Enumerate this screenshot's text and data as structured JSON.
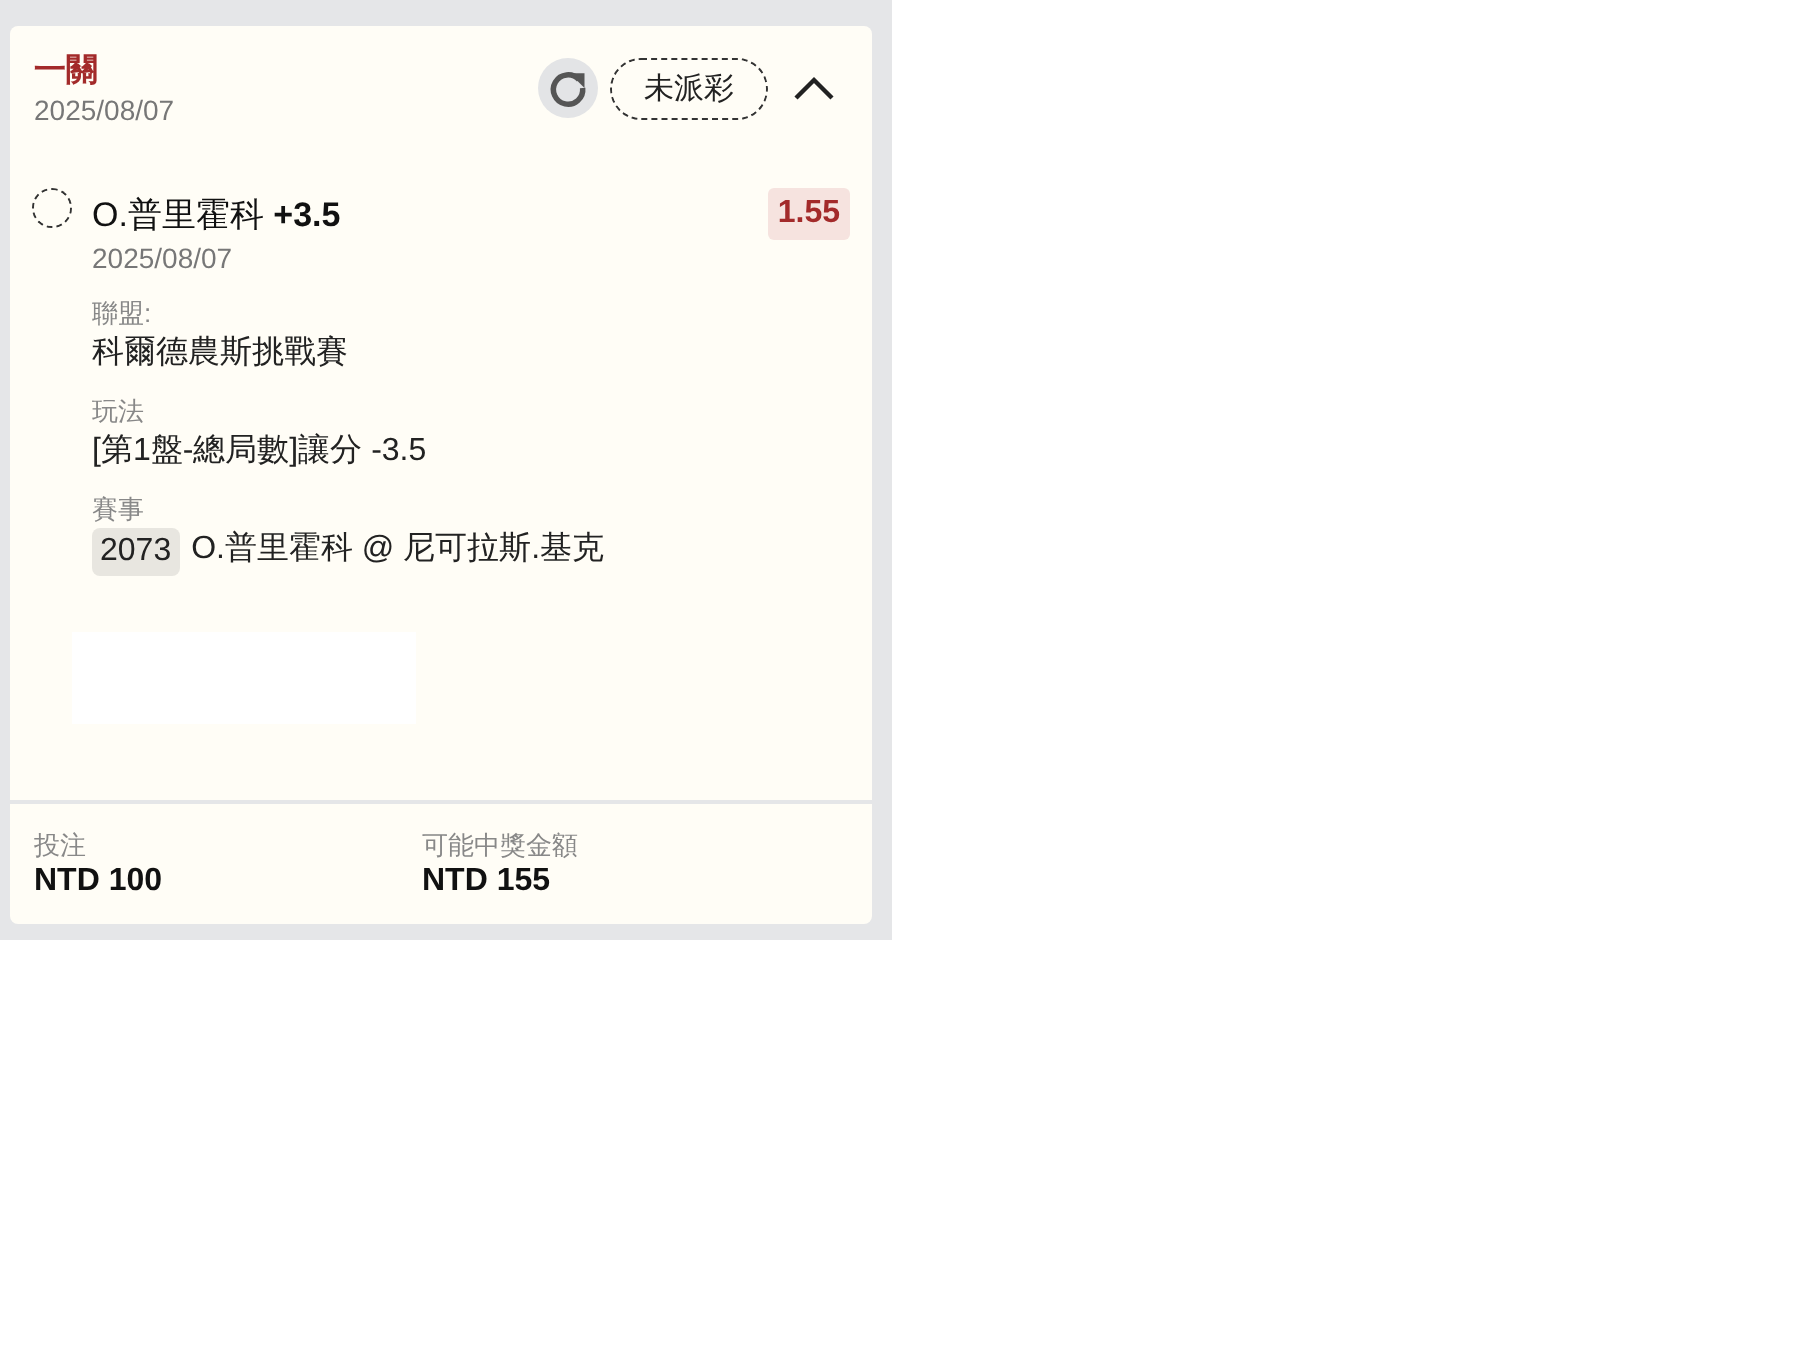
{
  "header": {
    "title": "一關",
    "date": "2025/08/07",
    "status": "未派彩",
    "expanded": true
  },
  "bet": {
    "selected": false,
    "selection": "O.普里霍科",
    "handicap": "+3.5",
    "odds": "1.55",
    "date": "2025/08/07",
    "details": [
      {
        "label": "聯盟:",
        "value": "科爾德農斯挑戰賽"
      },
      {
        "label": "玩法",
        "value": "[第1盤-總局數]讓分 -3.5"
      },
      {
        "label": "賽事",
        "code": "2073",
        "value": "O.普里霍科 @ 尼可拉斯.基克"
      }
    ]
  },
  "footer": [
    {
      "label": "投注",
      "value": "NTD 100"
    },
    {
      "label": "可能中獎金額",
      "value": "NTD 155"
    }
  ]
}
